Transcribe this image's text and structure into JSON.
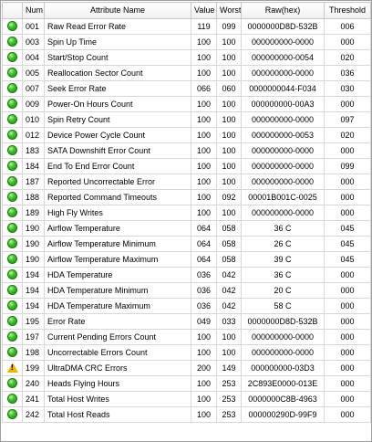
{
  "columns": {
    "icon": "",
    "num": "Num",
    "name": "Attribute Name",
    "value": "Value",
    "worst": "Worst",
    "raw": "Raw(hex)",
    "threshold": "Threshold"
  },
  "colors": {
    "ok": "#2fb31f",
    "warning": "#f3b400"
  },
  "rows": [
    {
      "status": "ok",
      "num": "001",
      "name": "Raw Read Error Rate",
      "value": "119",
      "worst": "099",
      "raw": "0000000D8D-532B",
      "threshold": "006"
    },
    {
      "status": "ok",
      "num": "003",
      "name": "Spin Up Time",
      "value": "100",
      "worst": "100",
      "raw": "000000000-0000",
      "threshold": "000"
    },
    {
      "status": "ok",
      "num": "004",
      "name": "Start/Stop Count",
      "value": "100",
      "worst": "100",
      "raw": "000000000-0054",
      "threshold": "020"
    },
    {
      "status": "ok",
      "num": "005",
      "name": "Reallocation Sector Count",
      "value": "100",
      "worst": "100",
      "raw": "000000000-0000",
      "threshold": "036"
    },
    {
      "status": "ok",
      "num": "007",
      "name": "Seek Error Rate",
      "value": "066",
      "worst": "060",
      "raw": "0000000044-F034",
      "threshold": "030"
    },
    {
      "status": "ok",
      "num": "009",
      "name": "Power-On Hours Count",
      "value": "100",
      "worst": "100",
      "raw": "000000000-00A3",
      "threshold": "000"
    },
    {
      "status": "ok",
      "num": "010",
      "name": "Spin Retry Count",
      "value": "100",
      "worst": "100",
      "raw": "000000000-0000",
      "threshold": "097"
    },
    {
      "status": "ok",
      "num": "012",
      "name": "Device Power Cycle Count",
      "value": "100",
      "worst": "100",
      "raw": "000000000-0053",
      "threshold": "020"
    },
    {
      "status": "ok",
      "num": "183",
      "name": "SATA Downshift Error Count",
      "value": "100",
      "worst": "100",
      "raw": "000000000-0000",
      "threshold": "000"
    },
    {
      "status": "ok",
      "num": "184",
      "name": "End To End Error Count",
      "value": "100",
      "worst": "100",
      "raw": "000000000-0000",
      "threshold": "099"
    },
    {
      "status": "ok",
      "num": "187",
      "name": "Reported Uncorrectable Error",
      "value": "100",
      "worst": "100",
      "raw": "000000000-0000",
      "threshold": "000"
    },
    {
      "status": "ok",
      "num": "188",
      "name": "Reported Command Timeouts",
      "value": "100",
      "worst": "092",
      "raw": "00001B001C-0025",
      "threshold": "000"
    },
    {
      "status": "ok",
      "num": "189",
      "name": "High Fly Writes",
      "value": "100",
      "worst": "100",
      "raw": "000000000-0000",
      "threshold": "000"
    },
    {
      "status": "ok",
      "num": "190",
      "name": "Airflow Temperature",
      "value": "064",
      "worst": "058",
      "raw": "36 C",
      "threshold": "045"
    },
    {
      "status": "ok",
      "num": "190",
      "name": "Airflow Temperature Minimum",
      "value": "064",
      "worst": "058",
      "raw": "26 C",
      "threshold": "045"
    },
    {
      "status": "ok",
      "num": "190",
      "name": "Airflow Temperature Maximum",
      "value": "064",
      "worst": "058",
      "raw": "39 C",
      "threshold": "045"
    },
    {
      "status": "ok",
      "num": "194",
      "name": "HDA Temperature",
      "value": "036",
      "worst": "042",
      "raw": "36 C",
      "threshold": "000"
    },
    {
      "status": "ok",
      "num": "194",
      "name": "HDA Temperature Minimum",
      "value": "036",
      "worst": "042",
      "raw": "20 C",
      "threshold": "000"
    },
    {
      "status": "ok",
      "num": "194",
      "name": "HDA Temperature Maximum",
      "value": "036",
      "worst": "042",
      "raw": "58 C",
      "threshold": "000"
    },
    {
      "status": "ok",
      "num": "195",
      "name": "Error Rate",
      "value": "049",
      "worst": "033",
      "raw": "0000000D8D-532B",
      "threshold": "000"
    },
    {
      "status": "ok",
      "num": "197",
      "name": "Current Pending Errors Count",
      "value": "100",
      "worst": "100",
      "raw": "000000000-0000",
      "threshold": "000"
    },
    {
      "status": "ok",
      "num": "198",
      "name": "Uncorrectable Errors Count",
      "value": "100",
      "worst": "100",
      "raw": "000000000-0000",
      "threshold": "000"
    },
    {
      "status": "warning",
      "num": "199",
      "name": "UltraDMA CRC Errors",
      "value": "200",
      "worst": "149",
      "raw": "000000000-03D3",
      "threshold": "000"
    },
    {
      "status": "ok",
      "num": "240",
      "name": "Heads Flying Hours",
      "value": "100",
      "worst": "253",
      "raw": "2C893E0000-013E",
      "threshold": "000"
    },
    {
      "status": "ok",
      "num": "241",
      "name": "Total Host Writes",
      "value": "100",
      "worst": "253",
      "raw": "0000000C8B-4963",
      "threshold": "000"
    },
    {
      "status": "ok",
      "num": "242",
      "name": "Total Host Reads",
      "value": "100",
      "worst": "253",
      "raw": "000000290D-99F9",
      "threshold": "000"
    }
  ]
}
